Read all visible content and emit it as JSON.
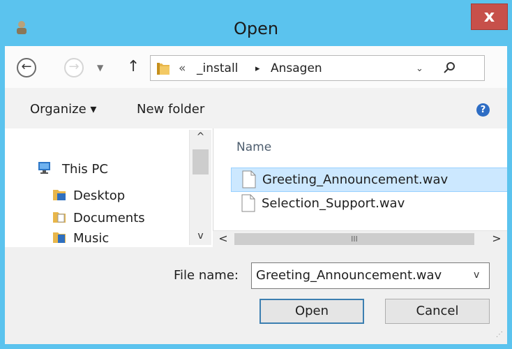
{
  "window": {
    "title": "Open",
    "close_label": "x",
    "app_icon": "user-icon"
  },
  "nav": {
    "back_glyph": "←",
    "forward_glyph": "→",
    "recent_glyph": "▼",
    "up_glyph": "↑",
    "breadcrumb": {
      "overflow": "«",
      "segments": [
        "_install",
        "Ansagen"
      ],
      "separator": "▸"
    },
    "dropdown_glyph": "⌄",
    "search_glyph": "⚲"
  },
  "toolbar": {
    "organize_label": "Organize ▾",
    "new_folder_label": "New folder",
    "help_glyph": "?"
  },
  "nav_pane": {
    "items": [
      {
        "label": "This PC",
        "icon": "computer-icon"
      },
      {
        "label": "Desktop",
        "icon": "desktop-folder-icon"
      },
      {
        "label": "Documents",
        "icon": "documents-folder-icon"
      },
      {
        "label": "Music",
        "icon": "music-folder-icon"
      }
    ],
    "scroll_up": "^",
    "scroll_down": "v"
  },
  "file_list": {
    "column_name": "Name",
    "files": [
      {
        "name": "Greeting_Announcement.wav",
        "selected": true
      },
      {
        "name": "Selection_Support.wav",
        "selected": false
      }
    ],
    "scroll_left": "<",
    "scroll_right": ">",
    "scroll_grip": "III"
  },
  "footer": {
    "file_name_label": "File name:",
    "file_name_value": "Greeting_Announcement.wav",
    "dropdown_glyph": "v",
    "open_label": "Open",
    "cancel_label": "Cancel"
  },
  "colors": {
    "title_bar": "#5bc3ee",
    "close_button": "#c7504a",
    "selection": "#cce8ff",
    "folder": "#e8b64a"
  }
}
